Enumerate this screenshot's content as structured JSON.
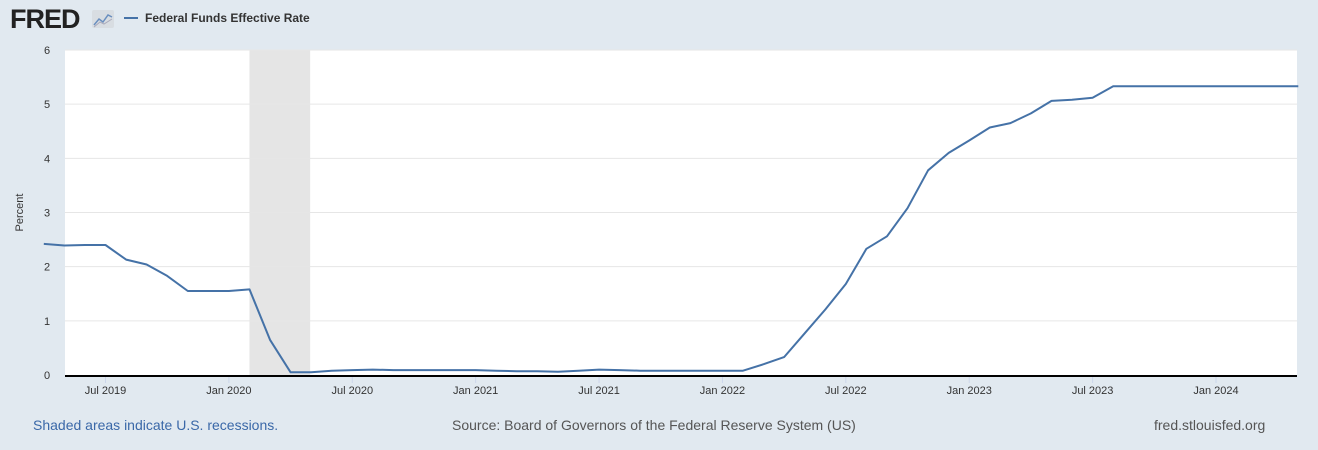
{
  "logo": "FRED",
  "chart_data": {
    "type": "line",
    "title": "",
    "ylabel": "Percent",
    "xlabel": "",
    "ylim": [
      0,
      6
    ],
    "yticks": [
      0,
      1,
      2,
      3,
      4,
      5,
      6
    ],
    "xticks": [
      "Jul 2019",
      "Jan 2020",
      "Jul 2020",
      "Jan 2021",
      "Jul 2021",
      "Jan 2022",
      "Jul 2022",
      "Jan 2023",
      "Jul 2023",
      "Jan 2024"
    ],
    "xtick_dates": [
      "2019-07",
      "2020-01",
      "2020-07",
      "2021-01",
      "2021-07",
      "2022-01",
      "2022-07",
      "2023-01",
      "2023-07",
      "2024-01"
    ],
    "grid": true,
    "legend_position": "top-left",
    "recessions": [
      [
        "2020-02",
        "2020-04"
      ]
    ],
    "series": [
      {
        "name": "Federal Funds Effective Rate",
        "color": "#4572a7",
        "start": "2019-04",
        "values": [
          2.42,
          2.39,
          2.4,
          2.4,
          2.13,
          2.04,
          1.83,
          1.55,
          1.55,
          1.55,
          1.58,
          0.65,
          0.05,
          0.05,
          0.08,
          0.09,
          0.1,
          0.09,
          0.09,
          0.09,
          0.09,
          0.09,
          0.08,
          0.07,
          0.07,
          0.06,
          0.08,
          0.1,
          0.09,
          0.08,
          0.08,
          0.08,
          0.08,
          0.08,
          0.08,
          0.2,
          0.33,
          0.77,
          1.21,
          1.68,
          2.33,
          2.56,
          3.08,
          3.78,
          4.1,
          4.33,
          4.57,
          4.65,
          4.83,
          5.06,
          5.08,
          5.12,
          5.33,
          5.33,
          5.33,
          5.33,
          5.33,
          5.33,
          5.33,
          5.33,
          5.33,
          5.33
        ]
      }
    ]
  },
  "footer": {
    "note": "Shaded areas indicate U.S. recessions.",
    "source": "Source: Board of Governors of the Federal Reserve System (US)",
    "site": "fred.stlouisfed.org"
  }
}
